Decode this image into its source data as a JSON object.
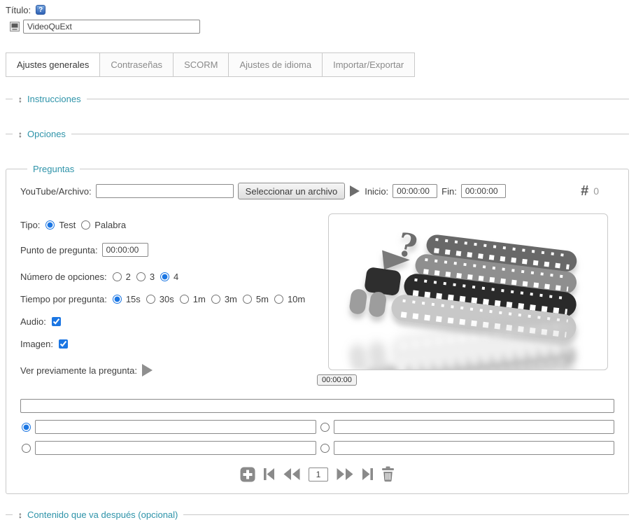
{
  "colors": {
    "accent_blue": "#1b76e3",
    "legend_teal": "#2e93a9",
    "icon_gray": "#8a8a8a",
    "time_green": "#3c7d3c"
  },
  "header": {
    "title_label": "Título:",
    "help_icon_glyph": "?",
    "title_value": "VideoQuExt"
  },
  "tabs": [
    {
      "label": "Ajustes generales",
      "active": true
    },
    {
      "label": "Contraseñas"
    },
    {
      "label": "SCORM"
    },
    {
      "label": "Ajustes de idioma"
    },
    {
      "label": "Importar/Exportar"
    }
  ],
  "sections": {
    "collapse_icon_glyph": "↕",
    "instrucciones": {
      "label": "Instrucciones"
    },
    "opciones": {
      "label": "Opciones"
    },
    "contenido": {
      "label": "Contenido que va después (opcional)"
    }
  },
  "preguntas": {
    "legend": "Preguntas",
    "youtube": {
      "label": "YouTube/Archivo:",
      "value": "",
      "button": "Seleccionar un archivo"
    },
    "inicio": {
      "label": "Inicio:",
      "value": "00:00:00"
    },
    "fin": {
      "label": "Fin:",
      "value": "00:00:00"
    },
    "counter": {
      "symbol": "#",
      "value": "0"
    },
    "tipo": {
      "label": "Tipo:",
      "options": [
        {
          "label": "Test",
          "checked": true
        },
        {
          "label": "Palabra"
        }
      ]
    },
    "punto": {
      "label": "Punto de pregunta:",
      "value": "00:00:00"
    },
    "numero": {
      "label": "Número de opciones:",
      "options": [
        {
          "label": "2"
        },
        {
          "label": "3"
        },
        {
          "label": "4",
          "checked": true
        }
      ]
    },
    "tiempo": {
      "label": "Tiempo por pregunta:",
      "options": [
        {
          "label": "15s",
          "checked": true
        },
        {
          "label": "30s"
        },
        {
          "label": "1m"
        },
        {
          "label": "3m"
        },
        {
          "label": "5m"
        },
        {
          "label": "10m"
        }
      ]
    },
    "audio": {
      "label": "Audio:",
      "checked": true
    },
    "imagen": {
      "label": "Imagen:",
      "checked": true
    },
    "preview": {
      "label": "Ver previamente la pregunta:"
    },
    "video_time_chip": "00:00:00",
    "question": {
      "value": ""
    },
    "answers": [
      {
        "value": "",
        "checked": true
      },
      {
        "value": ""
      },
      {
        "value": ""
      },
      {
        "value": ""
      }
    ],
    "nav": {
      "page": "1"
    }
  }
}
